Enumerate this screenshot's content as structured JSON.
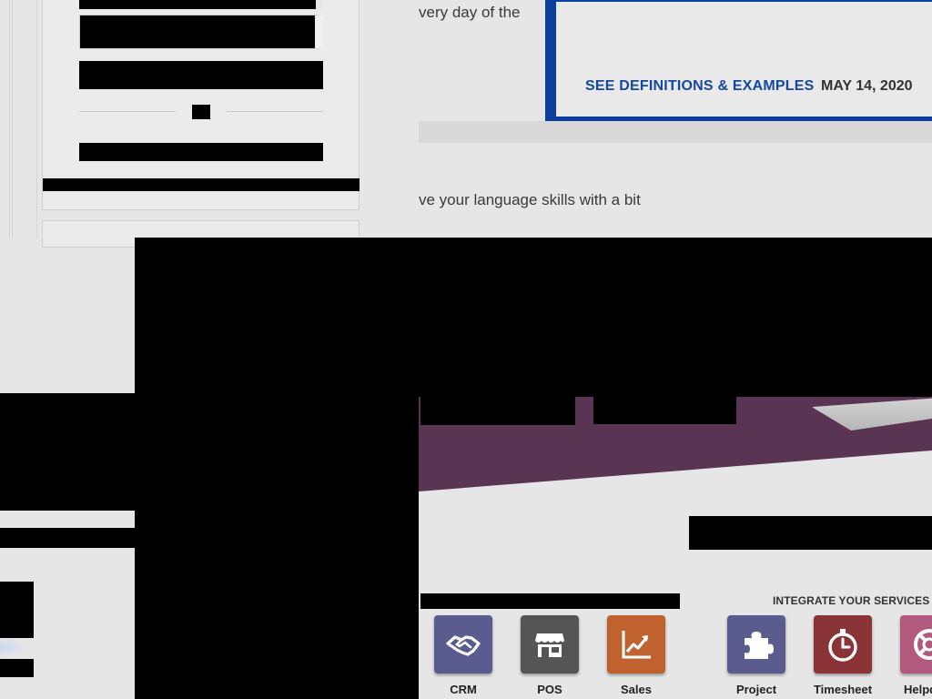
{
  "article": {
    "line1_fragment": "very day of the",
    "line2_fragment": "ve your language skills with a bit"
  },
  "card": {
    "link_label": "SEE DEFINITIONS & EXAMPLES",
    "date": "MAY 14, 2020"
  },
  "integrations": {
    "title": "INTEGRATE YOUR SERVICES",
    "apps": [
      {
        "label": "CRM",
        "icon": "handshake-icon",
        "color": "#5a5b8f"
      },
      {
        "label": "POS",
        "icon": "store-icon",
        "color": "#555555"
      },
      {
        "label": "Sales",
        "icon": "trend-chart-icon",
        "color": "#c0622e"
      },
      {
        "label": "Project",
        "icon": "puzzle-icon",
        "color": "#5a5b8f"
      },
      {
        "label": "Timesheet",
        "icon": "stopwatch-icon",
        "color": "#8a3438"
      },
      {
        "label": "Helpd",
        "icon": "lifebuoy-icon",
        "color": "#b25a7e"
      }
    ]
  },
  "colors": {
    "card_border": "#0f3f9e",
    "link": "#14479f",
    "banner": "#5a3553"
  }
}
